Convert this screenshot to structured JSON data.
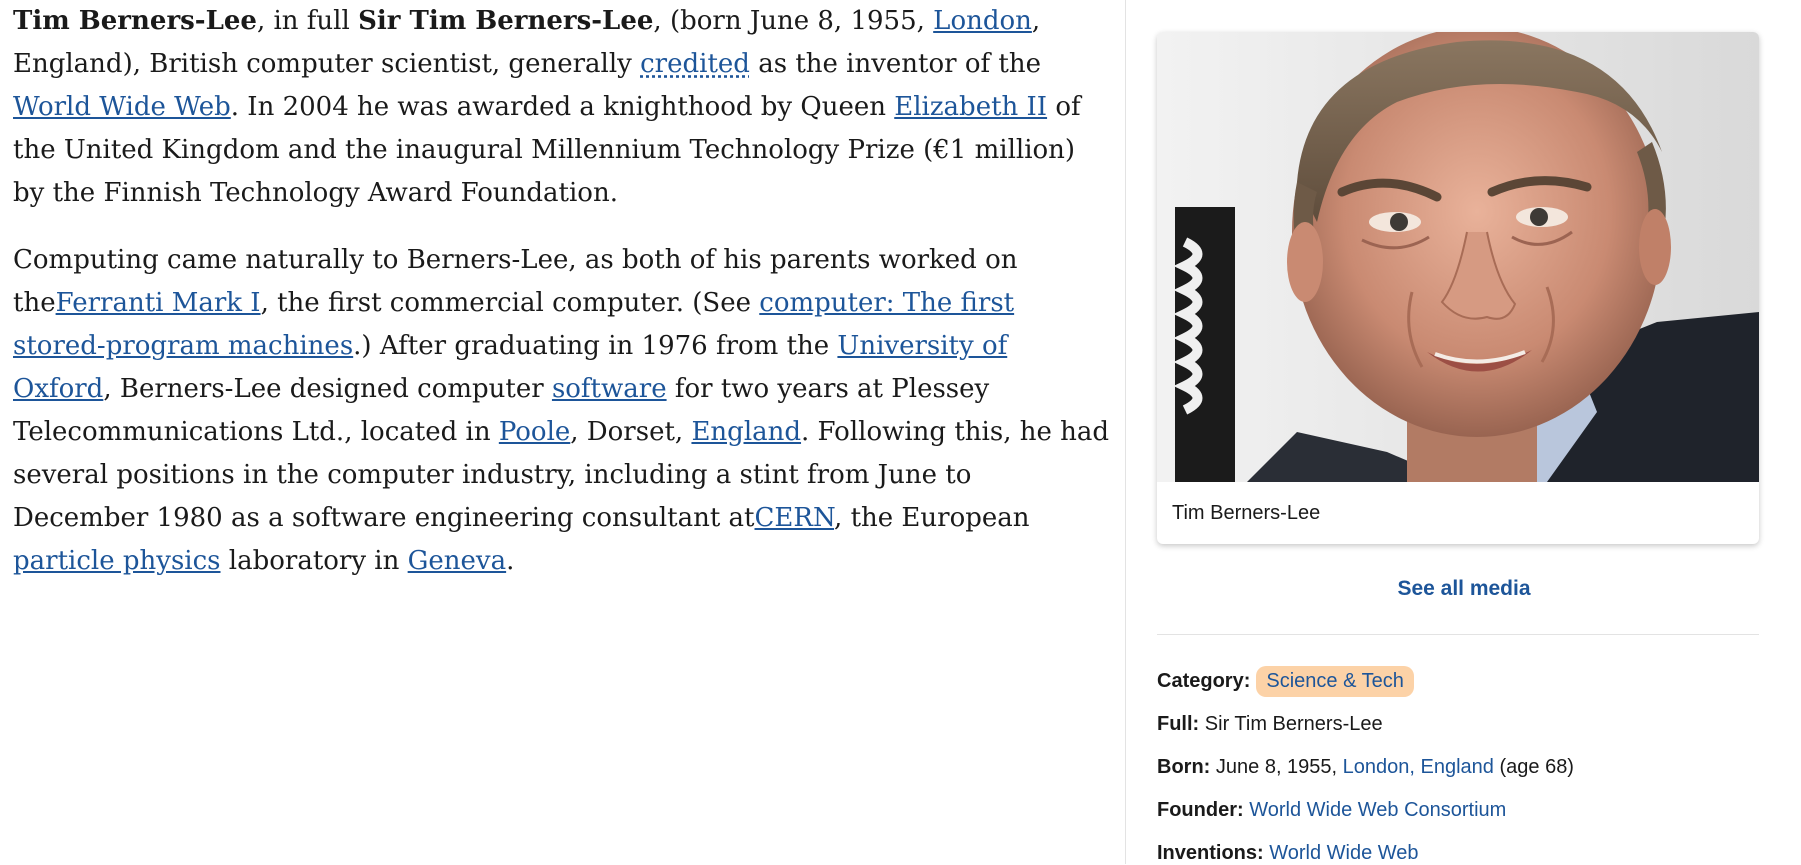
{
  "article": {
    "p1": {
      "name_bold": "Tim Berners-Lee",
      "t1": ", in full ",
      "fullname_bold": "Sir Tim Berners-Lee",
      "t2": ", (born June 8, 1955, ",
      "link_london": "London",
      "t3": ", England), British computer scientist, generally ",
      "link_credited": "credited",
      "t4": " as the inventor of the ",
      "link_www": "World Wide Web",
      "t5": ". In 2004 he was awarded a knighthood by Queen ",
      "link_elizabeth": "Elizabeth II",
      "t6": " of the United Kingdom and the inaugural Millennium Technology Prize (€1 million) by the Finnish Technology Award Foundation."
    },
    "p2": {
      "t1": "Computing came naturally to Berners-Lee, as both of his parents worked on the",
      "link_ferranti": "Ferranti Mark I",
      "t2": ", the first commercial computer. (See ",
      "link_computer": "computer: The first stored-program machines",
      "t3": ".) After graduating in 1976 from the ",
      "link_oxford": "University of Oxford",
      "t4": ", Berners-Lee designed computer ",
      "link_software": "software",
      "t5": " for two years at Plessey Telecommunications Ltd., located in ",
      "link_poole": "Poole",
      "t6": ", Dorset, ",
      "link_england": "England",
      "t7": ". Following this, he had several positions in the computer industry, including a stint from June to December 1980 as a software engineering consultant at",
      "link_cern": "CERN",
      "t8": ", the European ",
      "link_particle": "particle physics",
      "t9": " laboratory in ",
      "link_geneva": "Geneva",
      "t10": "."
    }
  },
  "sidebar": {
    "caption": "Tim Berners-Lee",
    "see_all": "See all media",
    "facts": {
      "category_label": "Category:",
      "category_value": "Science & Tech",
      "full_label": "Full:",
      "full_value": "Sir Tim Berners-Lee",
      "born_label": "Born:",
      "born_date": "June 8, 1955, ",
      "born_place": "London, England",
      "born_age": " (age 68)",
      "founder_label": "Founder:",
      "founder_value": "World Wide Web Consortium",
      "inventions_label": "Inventions:",
      "inventions_value": "World Wide Web"
    }
  },
  "colors": {
    "link": "#1d5599",
    "badge": "#fcd2a7",
    "text": "#1a1a1a"
  }
}
